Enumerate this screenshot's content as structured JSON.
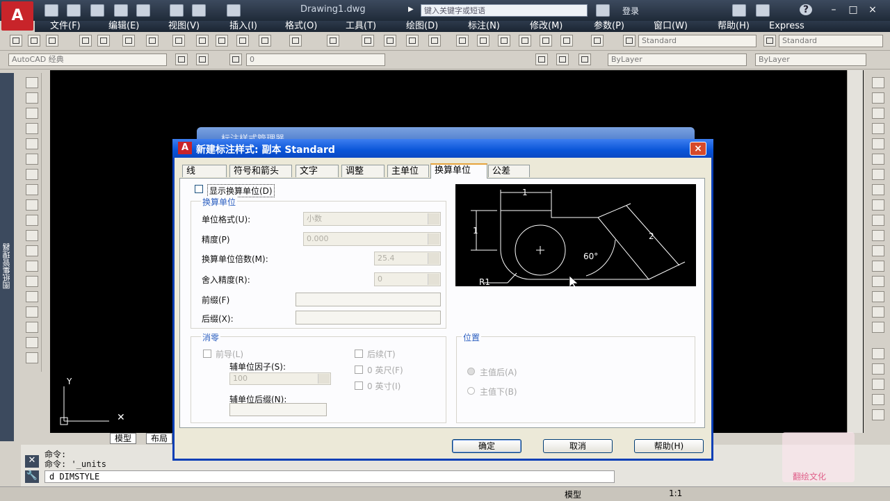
{
  "window": {
    "app_logo": "A",
    "document_title": "Drawing1.dwg",
    "search_placeholder": "键入关键字或短语",
    "sign_in": "登录",
    "help": "?",
    "minimize": "–",
    "maximize": "□",
    "close": "×"
  },
  "menu": [
    "文件(F)",
    "编辑(E)",
    "视图(V)",
    "插入(I)",
    "格式(O)",
    "工具(T)",
    "绘图(D)",
    "标注(N)",
    "修改(M)",
    "参数(P)",
    "窗口(W)",
    "帮助(H)",
    "Express"
  ],
  "toolbar2": {
    "workspace": "AutoCAD 经典",
    "layer_value": "0",
    "color_value": "ByLayer",
    "linetype_value": "ByLayer"
  },
  "toolbar1": {
    "text_style": "Standard",
    "dim_style": "Standard"
  },
  "left_strip_label": "图纸集管理器",
  "layout_tabs": [
    "模型",
    "布局"
  ],
  "command": {
    "line1": "命令:",
    "line2": "命令: '_units",
    "input": "d DIMSTYLE"
  },
  "status": {
    "model": "模型",
    "scale": "1:1"
  },
  "parent_dialog_title": "标注样式管理器",
  "dialog": {
    "icon": "A",
    "title": "新建标注样式: 副本 Standard",
    "close": "×",
    "tabs": [
      "线",
      "符号和箭头",
      "文字",
      "调整",
      "主单位",
      "换算单位",
      "公差"
    ],
    "active_tab": "换算单位",
    "show_alt_units": "显示换算单位(D)",
    "alt_units_group": "换算单位",
    "unit_format_label": "单位格式(U):",
    "unit_format_value": "小数",
    "precision_label": "精度(P)",
    "precision_value": "0.000",
    "multiplier_label": "换算单位倍数(M):",
    "multiplier_value": "25.4",
    "round_label": "舍入精度(R):",
    "round_value": "0",
    "prefix_label": "前缀(F)",
    "suffix_label": "后缀(X):",
    "zero_group": "消零",
    "leading": "前导(L)",
    "trailing": "后续(T)",
    "sub_factor_label": "辅单位因子(S):",
    "sub_factor_value": "100",
    "feet": "0 英尺(F)",
    "inches": "0 英寸(I)",
    "sub_suffix_label": "辅单位后缀(N):",
    "placement_group": "位置",
    "after_primary": "主值后(A)",
    "below_primary": "主值下(B)",
    "ok": "确定",
    "cancel": "取消",
    "help": "帮助(H)"
  },
  "preview": {
    "dim_top": "1",
    "dim_left": "1",
    "dim_slant": "2",
    "angle": "60°",
    "radius": "R1"
  },
  "watermark": "翻绘文化"
}
